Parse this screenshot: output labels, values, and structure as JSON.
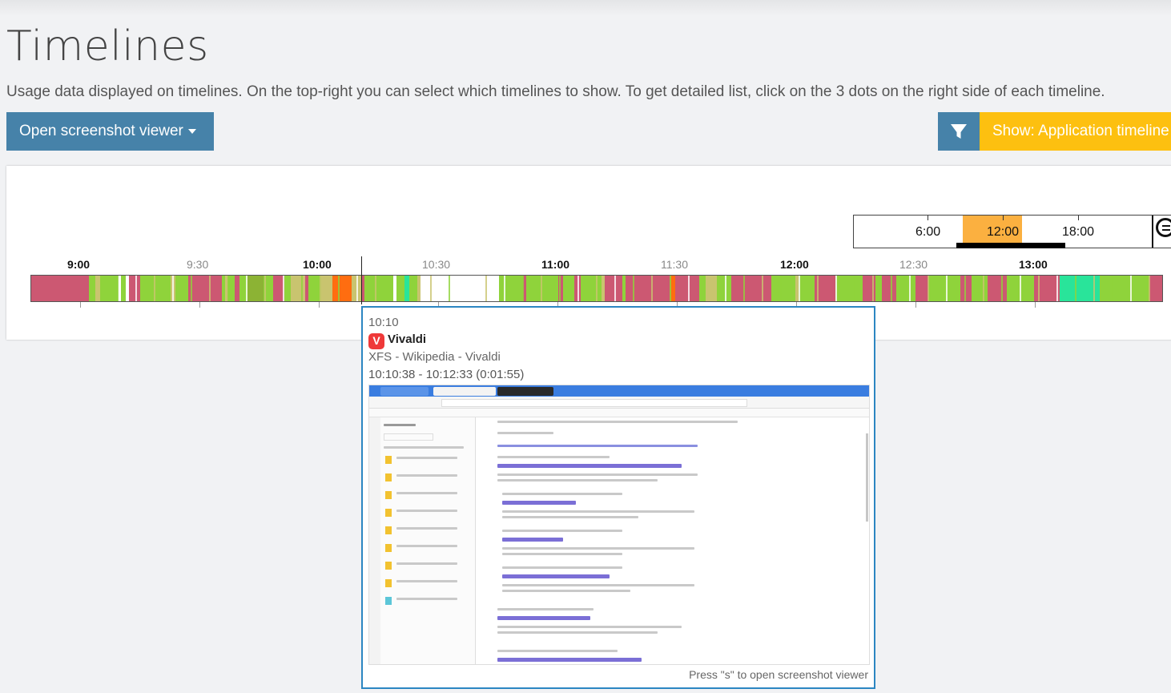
{
  "page": {
    "title": "Timelines",
    "description": "Usage data displayed on timelines. On the top-right you can select which timelines to show. To get detailed list, click on the 3 dots on the right side of each timeline."
  },
  "toolbar": {
    "viewer_button": "Open screenshot viewer",
    "filter_icon": "filter-icon",
    "show_button": "Show: Application timeline"
  },
  "zoom": {
    "labels": [
      "6:00",
      "12:00",
      "18:00"
    ],
    "selected": "12:00"
  },
  "timeline": {
    "hours": [
      {
        "label": "9:00",
        "major": true
      },
      {
        "label": "9:30",
        "major": false
      },
      {
        "label": "10:00",
        "major": true
      },
      {
        "label": "10:30",
        "major": false
      },
      {
        "label": "11:00",
        "major": true
      },
      {
        "label": "11:30",
        "major": false
      },
      {
        "label": "12:00",
        "major": true
      },
      {
        "label": "12:30",
        "major": false
      },
      {
        "label": "13:00",
        "major": true
      }
    ],
    "colors": {
      "red": "#cc5872",
      "green": "#8fd33b",
      "olive": "#8cb334",
      "tan": "#c9c46f",
      "orange": "#ff6d10",
      "teal": "#29e49a",
      "white": "#ffffff"
    }
  },
  "tooltip": {
    "time": "10:10",
    "app_icon": "vivaldi-icon",
    "app_name": "Vivaldi",
    "window_title": "XFS - Wikipedia - Vivaldi",
    "range": "10:10:38 - 10:12:33 (0:01:55)",
    "hint": "Press \"s\" to open screenshot viewer"
  }
}
